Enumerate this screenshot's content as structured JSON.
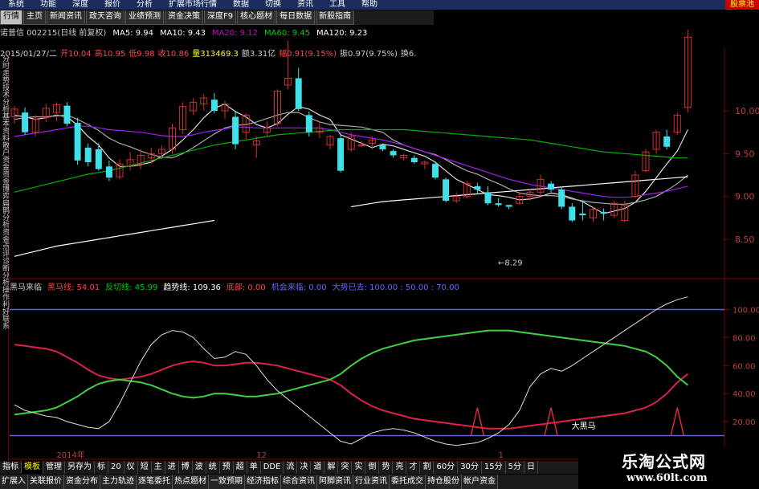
{
  "menu": [
    "系统",
    "功能",
    "深度",
    "报价",
    "分析",
    "扩展市场行情",
    "数据",
    "切换",
    "资讯",
    "工具",
    "帮助"
  ],
  "logo_text": "股票池",
  "tabs": [
    {
      "label": "行情",
      "hl": true
    },
    {
      "label": "主页"
    },
    {
      "label": "新闻资讯"
    },
    {
      "label": "政天咨询"
    },
    {
      "label": "业绩预测"
    },
    {
      "label": "资金决策"
    },
    {
      "label": "深度F9"
    },
    {
      "label": "核心题材"
    },
    {
      "label": "每日数据"
    },
    {
      "label": "新股指南"
    }
  ],
  "ma_legend": [
    {
      "t": "诺普信 002215(日线 前复权)",
      "c": "#ccc"
    },
    {
      "t": "MA5: 9.94",
      "c": "#fff"
    },
    {
      "t": "MA10: 9.43",
      "c": "#fff"
    },
    {
      "t": "MA20: 9.12",
      "c": "#c0c"
    },
    {
      "t": "MA60: 9.45",
      "c": "#0c0"
    },
    {
      "t": "MA120: 9.23",
      "c": "#fff"
    }
  ],
  "ohlc": [
    {
      "t": "2015/01/27/二",
      "c": "#ccc"
    },
    {
      "t": "开10.04",
      "c": "#f44"
    },
    {
      "t": "高10.95",
      "c": "#f44"
    },
    {
      "t": "低9.98",
      "c": "#f44"
    },
    {
      "t": "收10.86",
      "c": "#f44"
    },
    {
      "t": "量313469.3",
      "c": "#ff0"
    },
    {
      "t": "额3.31亿",
      "c": "#ccc"
    },
    {
      "t": "幅0.91(9.15%)",
      "c": "#f44"
    },
    {
      "t": "振0.97(9.75%)",
      "c": "#ccc"
    },
    {
      "t": "换6.",
      "c": "#ccc"
    }
  ],
  "left_labels": [
    "分时走势",
    "技术分析",
    "基本资料",
    "散户资金",
    "资金博弈",
    "扁鹊分析",
    "资金",
    "点评",
    "诊断",
    "分析",
    "操作",
    "利好",
    "联系"
  ],
  "price_axis": [
    "10.00",
    "9.50",
    "9.00",
    "8.50"
  ],
  "low_label": "8.29",
  "ind_legend": [
    {
      "t": "黑马来临",
      "c": "#ccc"
    },
    {
      "t": "黑马线: 54.01",
      "c": "#f44"
    },
    {
      "t": "反切线: 45.99",
      "c": "#0c0"
    },
    {
      "t": "趋势线: 109.36",
      "c": "#fff"
    },
    {
      "t": "底部: 0.00",
      "c": "#f44"
    },
    {
      "t": "机会来临: 0.00",
      "c": "#66f"
    },
    {
      "t": "大势已去: 100.00 : 50.00 : 70.00",
      "c": "#66f"
    }
  ],
  "ind_axis": [
    "100.00",
    "80.00",
    "60.00",
    "40.00",
    "20.00"
  ],
  "annot_label": "大黑马",
  "date_labels": [
    "2014年",
    "12",
    "1"
  ],
  "bottom_row1": [
    "指标",
    "模板",
    "管理",
    "另存为",
    "标",
    "20",
    "仪",
    "短",
    "主",
    "进",
    "博",
    "波",
    "统",
    "预",
    "超",
    "单",
    "DDE",
    "流",
    "决",
    "道",
    "解",
    "突",
    "实",
    "倒",
    "势",
    "亮",
    "才",
    "割",
    "60分",
    "30分",
    "15分",
    "5分",
    "日"
  ],
  "bottom_row2": [
    "扩展入",
    "关联报价",
    "资金分布",
    "主力轨迹",
    "逐笔委托",
    "热点题材",
    "一致预期",
    "经济指标",
    "综合资讯",
    "阿脚资讯",
    "行业资讯",
    "委托成交",
    "持仓股份",
    "帐户资金"
  ],
  "watermark_title": "乐淘公式网",
  "watermark_url": "www.60lt.com",
  "chart_data": {
    "type": "candlestick",
    "y_range": [
      8.2,
      10.45
    ],
    "candles": [
      [
        9.93,
        10.06,
        9.85,
        10.02
      ],
      [
        9.98,
        10.04,
        9.72,
        9.75
      ],
      [
        9.75,
        9.95,
        9.7,
        9.9
      ],
      [
        9.92,
        10.08,
        9.87,
        10.03
      ],
      [
        9.98,
        10.1,
        9.88,
        10.07
      ],
      [
        10.06,
        10.1,
        9.82,
        9.85
      ],
      [
        9.86,
        9.92,
        9.37,
        9.42
      ],
      [
        9.57,
        9.62,
        9.35,
        9.4
      ],
      [
        9.55,
        9.62,
        9.3,
        9.32
      ],
      [
        9.35,
        9.42,
        9.18,
        9.22
      ],
      [
        9.23,
        9.43,
        9.2,
        9.38
      ],
      [
        9.35,
        9.52,
        9.3,
        9.43
      ],
      [
        9.38,
        9.55,
        9.32,
        9.48
      ],
      [
        9.45,
        9.57,
        9.38,
        9.5
      ],
      [
        9.5,
        9.6,
        9.44,
        9.55
      ],
      [
        9.55,
        9.85,
        9.5,
        9.8
      ],
      [
        9.78,
        10.1,
        9.73,
        10.05
      ],
      [
        10.0,
        10.15,
        9.95,
        10.1
      ],
      [
        10.08,
        10.2,
        10.0,
        10.15
      ],
      [
        10.13,
        10.21,
        9.97,
        10.0
      ],
      [
        10.0,
        10.12,
        9.9,
        10.08
      ],
      [
        9.93,
        10.0,
        9.55,
        9.61
      ],
      [
        9.75,
        9.97,
        9.67,
        9.95
      ],
      [
        9.6,
        9.7,
        9.45,
        9.65
      ],
      [
        9.75,
        9.88,
        9.7,
        9.8
      ],
      [
        9.85,
        10.25,
        9.82,
        10.23
      ],
      [
        10.3,
        10.82,
        10.25,
        10.38
      ],
      [
        10.38,
        10.5,
        10.0,
        10.02
      ],
      [
        9.95,
        9.99,
        9.7,
        9.75
      ],
      [
        9.75,
        9.88,
        9.68,
        9.8
      ],
      [
        9.6,
        9.72,
        9.55,
        9.7
      ],
      [
        9.68,
        9.72,
        9.28,
        9.3
      ],
      [
        9.55,
        9.75,
        9.52,
        9.7
      ],
      [
        9.6,
        9.65,
        9.58,
        9.6
      ],
      [
        9.62,
        9.7,
        9.55,
        9.66
      ],
      [
        9.6,
        9.62,
        9.53,
        9.55
      ],
      [
        9.53,
        9.55,
        9.45,
        9.48
      ],
      [
        9.45,
        9.5,
        9.42,
        9.48
      ],
      [
        9.45,
        9.48,
        9.38,
        9.4
      ],
      [
        9.38,
        9.42,
        9.32,
        9.4
      ],
      [
        9.38,
        9.4,
        9.2,
        9.22
      ],
      [
        9.2,
        9.22,
        8.93,
        8.95
      ],
      [
        8.95,
        9.05,
        8.92,
        9.0
      ],
      [
        9.0,
        9.18,
        8.98,
        9.15
      ],
      [
        9.12,
        9.16,
        9.03,
        9.08
      ],
      [
        9.05,
        9.12,
        8.9,
        8.92
      ],
      [
        8.92,
        8.98,
        8.88,
        8.9
      ],
      [
        8.9,
        8.9,
        8.85,
        8.88
      ],
      [
        8.92,
        9.05,
        8.9,
        9.0
      ],
      [
        9.0,
        9.08,
        8.95,
        9.05
      ],
      [
        9.05,
        9.25,
        9.0,
        9.2
      ],
      [
        9.15,
        9.18,
        9.05,
        9.08
      ],
      [
        9.08,
        9.12,
        8.85,
        8.88
      ],
      [
        8.88,
        8.92,
        8.7,
        8.72
      ],
      [
        8.8,
        8.95,
        8.72,
        8.78
      ],
      [
        8.75,
        8.88,
        8.7,
        8.85
      ],
      [
        8.82,
        8.86,
        8.72,
        8.8
      ],
      [
        8.78,
        8.95,
        8.75,
        8.92
      ],
      [
        8.72,
        8.95,
        8.7,
        8.9
      ],
      [
        9.0,
        9.3,
        8.98,
        9.25
      ],
      [
        9.3,
        9.55,
        9.28,
        9.52
      ],
      [
        9.55,
        9.78,
        9.5,
        9.75
      ],
      [
        9.7,
        9.78,
        9.55,
        9.58
      ],
      [
        9.75,
        9.98,
        9.72,
        9.95
      ],
      [
        10.04,
        10.95,
        9.98,
        10.86
      ]
    ],
    "low_price": 8.29,
    "ma_lines": [
      {
        "name": "MA5",
        "color": "#ddd",
        "values": [
          9.95,
          9.93,
          9.9,
          9.92,
          9.95,
          9.93,
          9.83,
          9.7,
          9.6,
          9.45,
          9.35,
          9.35,
          9.37,
          9.4,
          9.47,
          9.55,
          9.66,
          9.78,
          9.92,
          10.03,
          10.08,
          9.99,
          9.93,
          9.84,
          9.8,
          9.85,
          9.96,
          10.05,
          10.02,
          9.95,
          9.9,
          9.72,
          9.67,
          9.62,
          9.57,
          9.61,
          9.59,
          9.55,
          9.51,
          9.47,
          9.4,
          9.3,
          9.2,
          9.14,
          9.08,
          9.02,
          9.01,
          8.99,
          8.96,
          8.97,
          9.0,
          9.04,
          9.02,
          8.98,
          8.94,
          8.87,
          8.8,
          8.83,
          8.86,
          8.93,
          9.06,
          9.22,
          9.38,
          9.53,
          9.78
        ]
      },
      {
        "name": "MA10",
        "color": "#aaa",
        "values": [
          9.9,
          9.92,
          9.93,
          9.93,
          9.94,
          9.95,
          9.9,
          9.84,
          9.77,
          9.68,
          9.62,
          9.58,
          9.53,
          9.49,
          9.46,
          9.45,
          9.5,
          9.57,
          9.65,
          9.73,
          9.8,
          9.83,
          9.84,
          9.87,
          9.91,
          9.95,
          9.98,
          9.98,
          9.92,
          9.87,
          9.84,
          9.83,
          9.82,
          9.81,
          9.78,
          9.75,
          9.66,
          9.6,
          9.56,
          9.52,
          9.49,
          9.43,
          9.36,
          9.3,
          9.26,
          9.2,
          9.15,
          9.09,
          9.04,
          9.02,
          9.01,
          9.01,
          9.0,
          8.97,
          8.95,
          8.93,
          8.92,
          8.91,
          8.91,
          8.93,
          8.96,
          9.0,
          9.07,
          9.15,
          9.25
        ]
      },
      {
        "name": "MA20",
        "color": "#a020f0",
        "values": [
          9.7,
          9.72,
          9.74,
          9.76,
          9.78,
          9.8,
          9.82,
          9.82,
          9.8,
          9.78,
          9.77,
          9.76,
          9.75,
          9.73,
          9.71,
          9.7,
          9.7,
          9.72,
          9.75,
          9.77,
          9.79,
          9.81,
          9.81,
          9.8,
          9.8,
          9.8,
          9.8,
          9.8,
          9.8,
          9.8,
          9.78,
          9.75,
          9.72,
          9.7,
          9.68,
          9.66,
          9.63,
          9.6,
          9.56,
          9.52,
          9.48,
          9.44,
          9.4,
          9.36,
          9.32,
          9.28,
          9.24,
          9.2,
          9.17,
          9.14,
          9.12,
          9.1,
          9.08,
          9.06,
          9.04,
          9.02,
          9.0,
          8.99,
          8.99,
          9.0,
          9.02,
          9.04,
          9.06,
          9.09,
          9.12
        ]
      },
      {
        "name": "MA60",
        "color": "#00b000",
        "values": [
          9.05,
          9.08,
          9.11,
          9.14,
          9.17,
          9.2,
          9.23,
          9.26,
          9.28,
          9.3,
          9.33,
          9.36,
          9.39,
          9.42,
          9.45,
          9.48,
          9.51,
          9.54,
          9.57,
          9.6,
          9.62,
          9.64,
          9.66,
          9.68,
          9.7,
          9.72,
          9.73,
          9.74,
          9.75,
          9.76,
          9.77,
          9.78,
          9.78,
          9.78,
          9.78,
          9.78,
          9.78,
          9.78,
          9.77,
          9.76,
          9.75,
          9.74,
          9.73,
          9.72,
          9.71,
          9.7,
          9.69,
          9.68,
          9.67,
          9.66,
          9.64,
          9.62,
          9.6,
          9.58,
          9.56,
          9.54,
          9.52,
          9.51,
          9.5,
          9.49,
          9.48,
          9.47,
          9.46,
          9.45,
          9.45
        ]
      },
      {
        "name": "MA120",
        "color": "#fff",
        "values": [
          8.3,
          8.33,
          8.36,
          8.39,
          8.42,
          8.44,
          8.46,
          8.48,
          8.5,
          8.52,
          8.54,
          8.56,
          8.58,
          8.6,
          8.62,
          8.64,
          8.66,
          8.68,
          8.7,
          8.72,
          null,
          null,
          null,
          null,
          null,
          null,
          null,
          null,
          null,
          null,
          null,
          null,
          8.88,
          8.9,
          8.92,
          8.94,
          8.95,
          8.96,
          8.97,
          8.98,
          8.99,
          9.0,
          9.01,
          9.02,
          9.03,
          9.04,
          9.05,
          9.06,
          9.07,
          9.08,
          9.09,
          9.1,
          9.11,
          9.12,
          9.13,
          9.14,
          9.15,
          9.16,
          9.17,
          9.18,
          9.19,
          9.2,
          9.21,
          9.22,
          9.23
        ]
      }
    ],
    "indicator": {
      "y_range": [
        0,
        110
      ],
      "levels": [
        100,
        10
      ],
      "series": [
        {
          "name": "黑马线",
          "color": "#e0204a",
          "values": [
            75,
            74,
            73,
            72,
            70,
            66,
            62,
            57,
            53,
            51,
            50,
            51,
            52,
            54,
            57,
            60,
            62,
            63,
            62,
            60,
            60,
            61,
            62,
            62,
            61,
            60,
            58,
            56,
            54,
            52,
            50,
            46,
            40,
            35,
            31,
            28,
            26,
            24,
            22,
            21,
            20,
            19,
            18,
            17,
            16,
            15,
            15,
            15,
            16,
            17,
            18,
            19,
            20,
            21,
            22,
            23,
            24,
            25,
            26,
            28,
            30,
            34,
            40,
            48,
            54
          ]
        },
        {
          "name": "反切线",
          "color": "#40d040",
          "values": [
            25,
            26,
            27,
            28,
            30,
            34,
            38,
            43,
            47,
            49,
            50,
            49,
            48,
            46,
            43,
            40,
            38,
            37,
            38,
            40,
            40,
            39,
            38,
            38,
            39,
            40,
            42,
            44,
            46,
            48,
            50,
            54,
            60,
            65,
            69,
            72,
            74,
            76,
            78,
            79,
            80,
            81,
            82,
            83,
            84,
            85,
            85,
            85,
            84,
            83,
            82,
            81,
            80,
            79,
            78,
            77,
            76,
            75,
            74,
            72,
            70,
            66,
            60,
            52,
            46
          ]
        },
        {
          "name": "趋势线",
          "color": "#ddd",
          "values": [
            32,
            28,
            26,
            24,
            23,
            20,
            18,
            16,
            15,
            20,
            33,
            48,
            63,
            75,
            82,
            85,
            84,
            80,
            72,
            65,
            66,
            70,
            68,
            60,
            50,
            42,
            36,
            30,
            24,
            18,
            12,
            6,
            4,
            8,
            12,
            14,
            15,
            14,
            12,
            9,
            6,
            4,
            3,
            4,
            5,
            8,
            12,
            18,
            28,
            45,
            54,
            58,
            56,
            60,
            65,
            70,
            75,
            80,
            85,
            90,
            95,
            100,
            104,
            107,
            109
          ]
        }
      ],
      "peaks": [
        44,
        51,
        63
      ],
      "annot_index": 56
    }
  }
}
